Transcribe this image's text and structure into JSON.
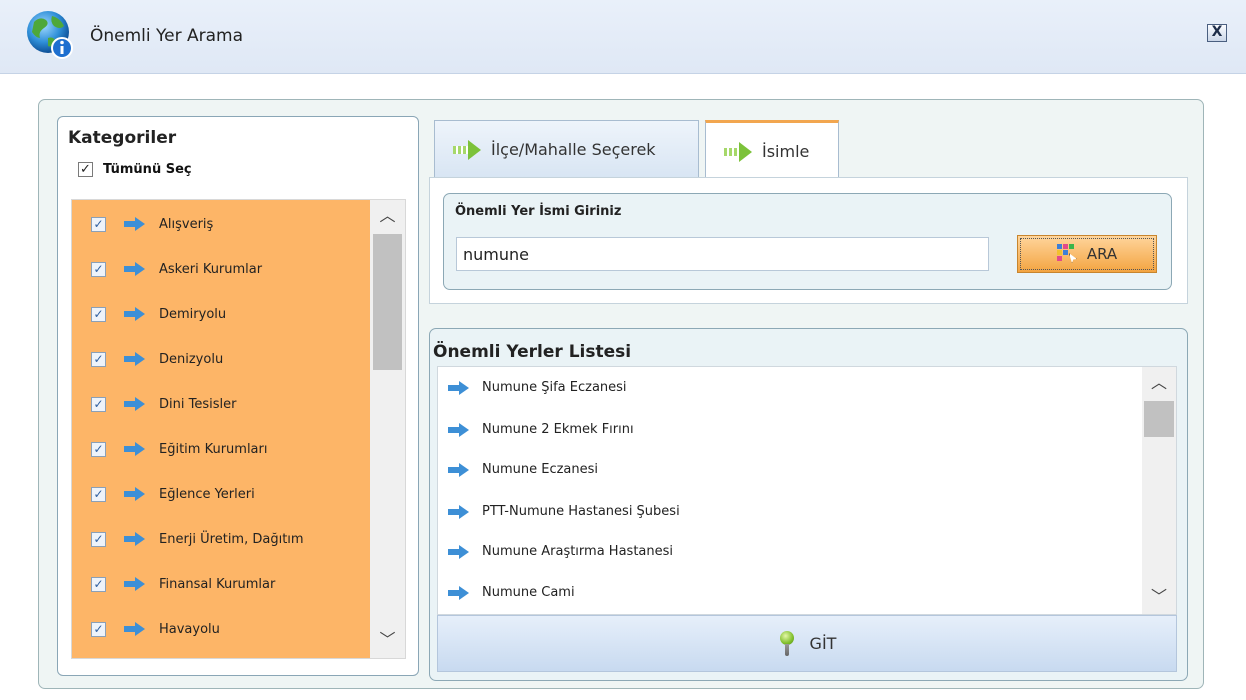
{
  "window": {
    "title": "Önemli Yer Arama",
    "close_label": "X"
  },
  "categories": {
    "title": "Kategoriler",
    "select_all_label": "Tümünü Seç",
    "select_all_checked": true,
    "items": [
      {
        "label": "Alışveriş",
        "checked": true
      },
      {
        "label": "Askeri Kurumlar",
        "checked": true
      },
      {
        "label": "Demiryolu",
        "checked": true
      },
      {
        "label": "Denizyolu",
        "checked": true
      },
      {
        "label": "Dini Tesisler",
        "checked": true
      },
      {
        "label": "Eğitim Kurumları",
        "checked": true
      },
      {
        "label": "Eğlence Yerleri",
        "checked": true
      },
      {
        "label": "Enerji Üretim, Dağıtım",
        "checked": true
      },
      {
        "label": "Finansal Kurumlar",
        "checked": true
      },
      {
        "label": "Havayolu",
        "checked": true
      }
    ],
    "highlight_color": "#fdb567"
  },
  "tabs": [
    {
      "label": "İlçe/Mahalle Seçerek",
      "active": false
    },
    {
      "label": "İsimle",
      "active": true
    }
  ],
  "search": {
    "label": "Önemli Yer İsmi Giriniz",
    "value": "numune",
    "button_label": "ARA"
  },
  "results": {
    "title": "Önemli Yerler Listesi",
    "items": [
      "Numune Şifa Eczanesi",
      "Numune 2 Ekmek Fırını",
      "Numune Eczanesi",
      "PTT-Numune Hastanesi Şubesi",
      "Numune Araştırma Hastanesi",
      "Numune Cami"
    ],
    "go_button_label": "GİT"
  },
  "icons": {
    "app": "globe-info-icon",
    "category_item": "blue-arrow-icon",
    "tab": "green-arrow-icon",
    "search_button": "grid-cursor-icon",
    "go_button": "map-pin-icon"
  }
}
